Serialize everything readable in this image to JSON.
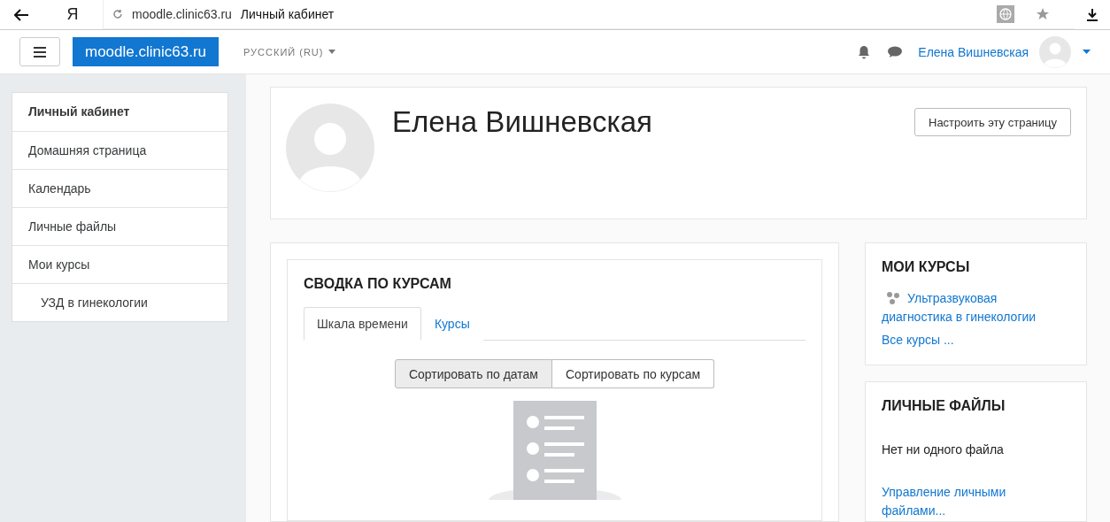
{
  "browser": {
    "logo": "Я",
    "domain": "moodle.clinic63.ru",
    "title": "Личный кабинет"
  },
  "navbar": {
    "site": "moodle.clinic63.ru",
    "language": "РУССКИЙ (RU)",
    "user": "Елена Вишневская"
  },
  "sidebar": {
    "items": [
      {
        "label": "Личный кабинет",
        "selected": true
      },
      {
        "label": "Домашняя страница",
        "selected": false
      },
      {
        "label": "Календарь",
        "selected": false
      },
      {
        "label": "Личные файлы",
        "selected": false
      },
      {
        "label": "Мои курсы",
        "selected": false,
        "children": [
          {
            "label": "УЗД в гинекологии",
            "selected": false
          }
        ]
      }
    ]
  },
  "header": {
    "name": "Елена Вишневская",
    "button": "Настроить эту страницу"
  },
  "overview": {
    "title": "СВОДКА ПО КУРСАМ",
    "tabs": [
      {
        "label": "Шкала времени",
        "selected": true
      },
      {
        "label": "Курсы",
        "selected": false
      }
    ],
    "sort": [
      {
        "label": "Сортировать по датам",
        "selected": true
      },
      {
        "label": "Сортировать по курсам",
        "selected": false
      }
    ]
  },
  "blocks": [
    {
      "kind": "courses",
      "title": "МОИ КУРСЫ",
      "course": "Ультразвуковая диагностика в гинекологии",
      "link": "Все курсы ..."
    },
    {
      "kind": "files",
      "title": "ЛИЧНЫЕ ФАЙЛЫ",
      "text": "Нет ни одного файла",
      "link": "Управление личными файлами..."
    }
  ]
}
